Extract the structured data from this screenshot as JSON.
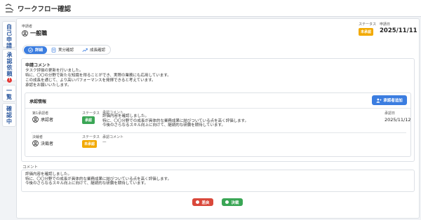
{
  "header": {
    "title": "ワークフロー確認"
  },
  "sidebar": {
    "items": [
      {
        "label": "自己申請",
        "badge": ""
      },
      {
        "label": "承認依頼",
        "badge": "!"
      },
      {
        "label": "一覧",
        "badge": ""
      },
      {
        "label": "確認中",
        "badge": ""
      }
    ]
  },
  "applicant": {
    "label": "申請者",
    "name": "一般職"
  },
  "status": {
    "label": "ステータス",
    "value": "未承認"
  },
  "apply_date": {
    "label": "申請日",
    "value": "2025/11/11"
  },
  "tabs": [
    {
      "label": "詳細",
      "icon": "check-icon"
    },
    {
      "label": "実分確認",
      "icon": "document-icon"
    },
    {
      "label": "成長確認",
      "icon": "trend-icon"
    }
  ],
  "comment_section": {
    "title": "申請コメント",
    "lines": [
      "タスク評価の更新を行いました。",
      "特に、〇〇の分野で新たな知識を得ることができ、実際の業務にも応用しています。",
      "この成長を通じて、より高いパフォーマンスを発揮できると考えています。",
      "承認をお願いいたします。"
    ]
  },
  "approval": {
    "title": "承認情報",
    "add_button": "承認者追加",
    "rows": [
      {
        "role_label": "第1承認者",
        "name": "承認者",
        "status_label": "ステータス",
        "status": "承認",
        "comment_label": "承認コメント",
        "comment_lines": [
          "評価内容を確認しました。",
          "特に、〇〇分野での成長が具体的な業務成果に結びついている点を高く評価します。",
          "今後のさらなるスキル向上に向けて、継続的な研鑽を期待しています。"
        ],
        "date_label": "承認日",
        "date": "2025/11/12"
      },
      {
        "role_label": "決裁者",
        "name": "決裁者",
        "status_label": "ステータス",
        "status": "未承認",
        "comment_label": "承認コメント",
        "comment_lines": [
          "—"
        ],
        "date_label": "",
        "date": ""
      }
    ]
  },
  "comment_input": {
    "label": "コメント",
    "lines": [
      "評価内容を確認しました。",
      "特に、〇〇分野での成長が具体的な業務成果に結びついている点を高く評価します。",
      "今後のさらなるスキル向上に向けて、継続的な研鑽を期待しています。"
    ]
  },
  "actions": {
    "reject": "差戻",
    "approve": "決裁"
  },
  "colors": {
    "accent": "#3b7de0",
    "pending": "#f2a900",
    "approved": "#3aa655",
    "reject": "#d9483b"
  }
}
